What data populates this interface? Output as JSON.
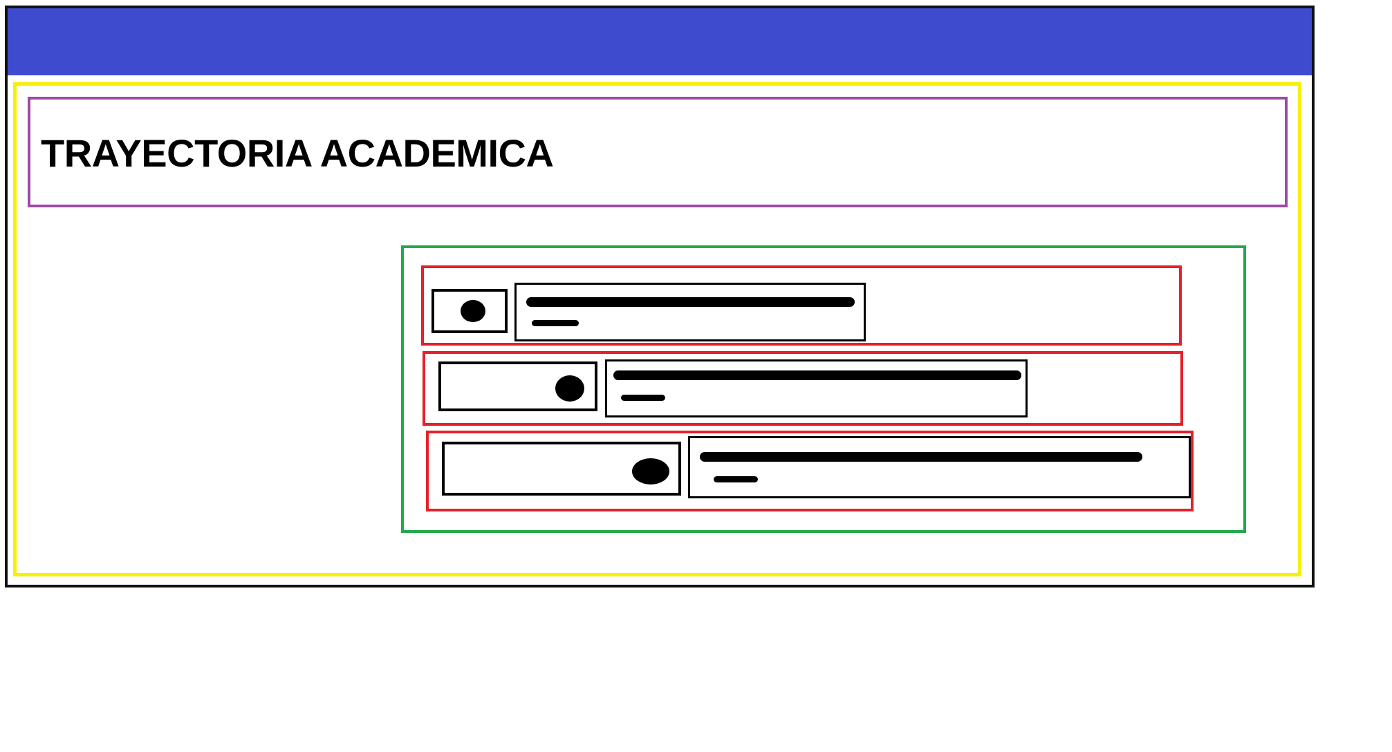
{
  "page": {
    "title": "TRAYECTORIA ACADEMICA"
  },
  "colors": {
    "header": "#3f4bce",
    "content_frame": "#f7f000",
    "title_box": "#9b4aa6",
    "list_panel": "#23a94a",
    "item_row": "#e5202a",
    "outline": "#000000"
  },
  "items": [
    {
      "toggle_state": "off",
      "content": "redacted-text-lines"
    },
    {
      "toggle_state": "on",
      "content": "redacted-text-lines"
    },
    {
      "toggle_state": "on",
      "content": "redacted-text-lines"
    }
  ]
}
